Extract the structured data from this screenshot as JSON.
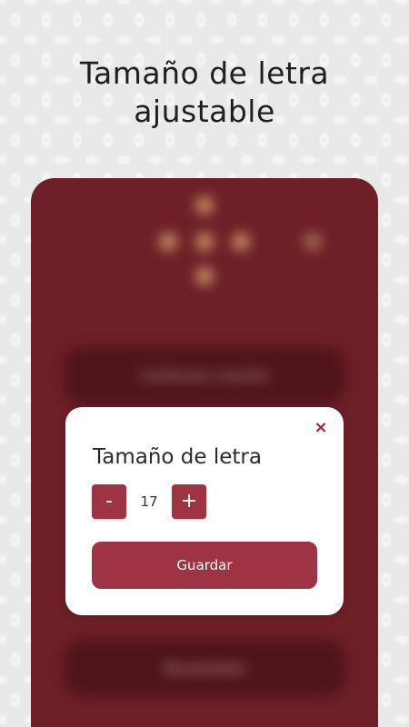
{
  "headline": {
    "line1": "Tamaño de letra",
    "line2": "ajustable"
  },
  "background_app": {
    "button_1_label": "Continuar oración",
    "button_2_label": "Novedades"
  },
  "dialog": {
    "title": "Tamaño de letra",
    "close_icon": "close-icon",
    "close_glyph": "×",
    "decrease_label": "-",
    "font_size_value": "17",
    "increase_label": "+",
    "save_label": "Guardar"
  },
  "colors": {
    "accent": "#9e3443",
    "app_background": "#6e1f27",
    "close_icon": "#9b2233",
    "page_background": "#e9e9e9"
  }
}
